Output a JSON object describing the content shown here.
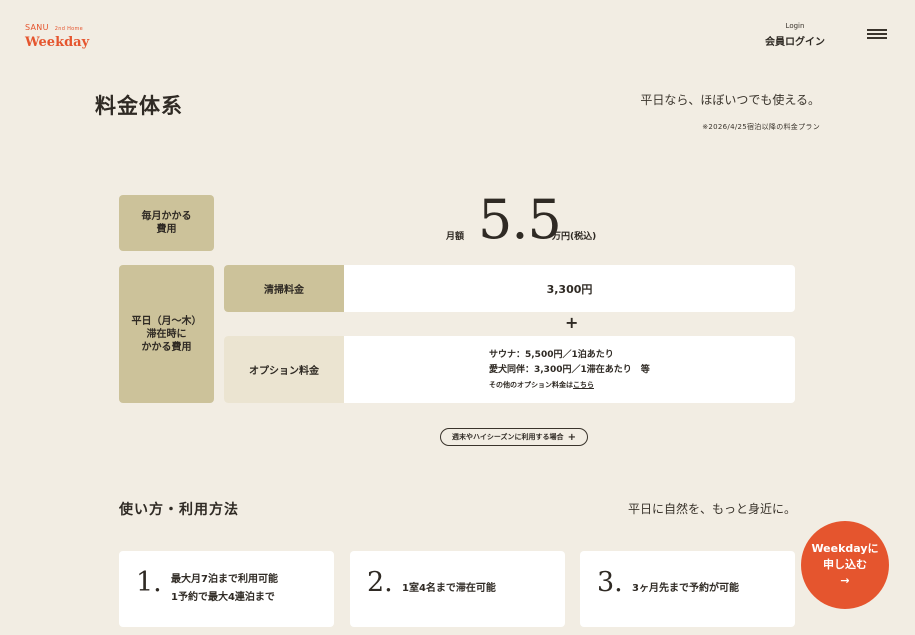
{
  "header": {
    "logo_line1": "SANU",
    "logo_line1_sub": "2nd Home",
    "logo_line2": "Weekday",
    "login_small": "Login",
    "login_label": "会員ログイン",
    "menu_icon": "hamburger-icon"
  },
  "hero": {
    "title": "料金体系",
    "tagline": "平日なら、ほぼいつでも使える。",
    "note": "※2026/4/25宿泊以降の料金プラン"
  },
  "pricing": {
    "monthly_label": "毎月かかる\n費用",
    "price_prefix": "月額",
    "price_value": "5.5",
    "price_suffix": "万円(税込)",
    "weekday_label": "平日（月〜木）\n滞在時に\nかかる費用",
    "cleaning_label": "清掃料金",
    "cleaning_value": "3,300円",
    "plus": "+",
    "option_label": "オプション料金",
    "option_line1": "サウナ：5,500円／1泊あたり",
    "option_line2": "愛犬同伴：3,300円／1滞在あたり　等",
    "option_small_prefix": "その他のオプション料金は",
    "option_small_link": "こちら",
    "season_button": "週末やハイシーズンに利用する場合",
    "season_button_icon": "+"
  },
  "usage": {
    "title": "使い方・利用方法",
    "tagline": "平日に自然を、もっと身近に。",
    "cards": [
      {
        "num": "1.",
        "line1": "最大月7泊まで利用可能",
        "line2": "1予約で最大4連泊まで"
      },
      {
        "num": "2.",
        "line1": "1室4名まで滞在可能",
        "line2": ""
      },
      {
        "num": "3.",
        "line1": "3ヶ月先まで予約が可能",
        "line2": ""
      }
    ]
  },
  "cta": {
    "line1": "Weekdayに",
    "line2": "申し込む",
    "arrow": "→"
  },
  "colors": {
    "background": "#f2ede3",
    "accent": "#e5552e",
    "label_fill": "#ccc29a",
    "label_fill_light": "#ebe4d1"
  }
}
